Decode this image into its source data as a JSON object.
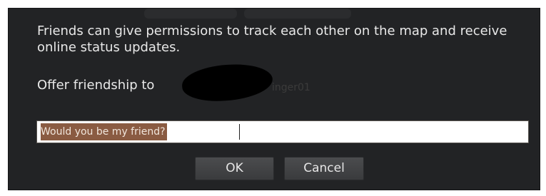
{
  "dialog": {
    "message": "Friends can give permissions to track each other on the map and receive online status updates.",
    "offer_label": "Offer friendship to",
    "recipient_partial": "inger01",
    "input_value": "Would you be my friend?",
    "buttons": {
      "ok_label": "OK",
      "cancel_label": "Cancel"
    }
  },
  "colors": {
    "dialog_bg": "#222325",
    "text": "#e8e8e8",
    "selection": "#8a5b42",
    "button": "#414244"
  }
}
